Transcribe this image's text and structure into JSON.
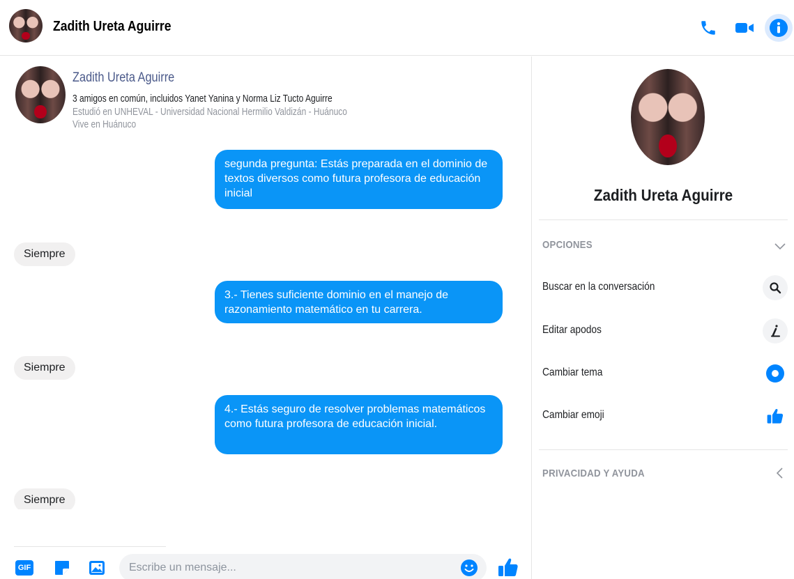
{
  "header": {
    "title": "Zadith Ureta Aguirre",
    "icons": [
      "phone-icon",
      "video-camera-icon",
      "info-icon"
    ]
  },
  "profile": {
    "name": "Zadith Ureta Aguirre",
    "mutual_friends": "3 amigos en común, incluidos Yanet Yanina y Norma Liz Tucto Aguirre",
    "studied": "Estudió en UNHEVAL - Universidad Nacional Hermilio Valdizán - Huánuco",
    "lives": "Vive en Huánuco"
  },
  "messages": [
    {
      "direction": "out",
      "text": "segunda pregunta: Estás  preparada en el dominio  de textos  diversos como  futura profesora de educación inicial"
    },
    {
      "direction": "in",
      "text": "Siempre"
    },
    {
      "direction": "out",
      "text": "3.- Tienes  suficiente dominio  en el manejo  de razonamiento  matemático en tu carrera."
    },
    {
      "direction": "in",
      "text": "Siempre"
    },
    {
      "direction": "out",
      "text": "4.- Estás  seguro  de resolver  problemas matemáticos como  futura  profesora de educación  inicial."
    },
    {
      "direction": "in",
      "text": "Siempre"
    }
  ],
  "composer": {
    "placeholder": "Escribe un mensaje...",
    "gif_label": "GIF",
    "icons": [
      "gif-icon",
      "sticker-icon",
      "image-icon",
      "emoji-icon",
      "thumbs-up-icon"
    ]
  },
  "sidebar": {
    "name": "Zadith Ureta Aguirre",
    "options_title": "OPCIONES",
    "options": [
      {
        "label": "Buscar en la conversación",
        "icon": "search-icon"
      },
      {
        "label": "Editar apodos",
        "icon": "edit-nickname-icon"
      },
      {
        "label": "Cambiar tema",
        "icon": "theme-color-icon"
      },
      {
        "label": "Cambiar emoji",
        "icon": "thumbs-up-icon"
      }
    ],
    "privacy_title": "PRIVACIDAD Y AYUDA"
  },
  "colors": {
    "accent": "#0084ff",
    "outgoing_bubble": "#0a95f7",
    "incoming_bubble": "#f1f0f0"
  }
}
